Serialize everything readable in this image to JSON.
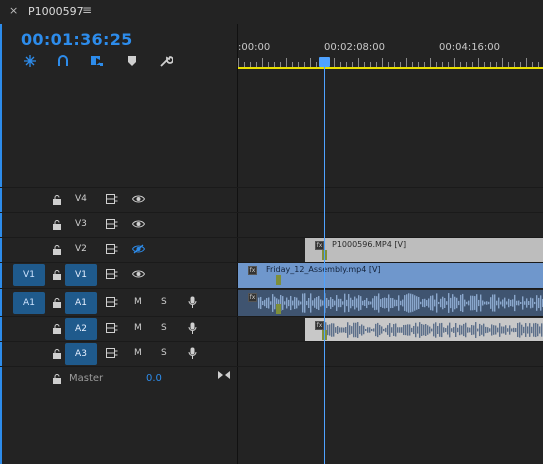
{
  "tab": {
    "close": "×",
    "title": "P1000597",
    "menu": "≡"
  },
  "timecode": "00:01:36:25",
  "toolbar": {
    "icons": [
      "snap-icon",
      "linked-selection-icon",
      "add-marker-icon",
      "marker-icon",
      "wrench-icon"
    ]
  },
  "ruler": {
    "labels": [
      ":00:00",
      "00:02:08:00",
      "00:04:16:00"
    ]
  },
  "video_tracks": [
    {
      "name": "V4",
      "source": "",
      "sync_lock": true,
      "output_visible": true
    },
    {
      "name": "V3",
      "source": "",
      "sync_lock": true,
      "output_visible": true
    },
    {
      "name": "V2",
      "source": "",
      "sync_lock": true,
      "output_visible": false
    },
    {
      "name": "V1",
      "source": "V1",
      "sync_lock": true,
      "output_visible": true
    }
  ],
  "audio_tracks": [
    {
      "name": "A1",
      "source": "A1",
      "mute": "M",
      "solo": "S"
    },
    {
      "name": "A2",
      "source": "",
      "mute": "M",
      "solo": "S"
    },
    {
      "name": "A3",
      "source": "",
      "mute": "M",
      "solo": "S"
    }
  ],
  "master": {
    "label": "Master",
    "value": "0.0"
  },
  "clips": {
    "v2_clip": "P1000596.MP4 [V]",
    "v1_clip": "Friday_12_Assembly.mp4 [V]",
    "fx": "fx"
  },
  "colors": {
    "accent": "#2d8ceb",
    "playhead": "#4fa2ff",
    "v1_clip": "#6f97cc",
    "v2_clip": "#bdbdbd",
    "audio_clip": "#3f5470",
    "target": "#1f5a8c"
  }
}
